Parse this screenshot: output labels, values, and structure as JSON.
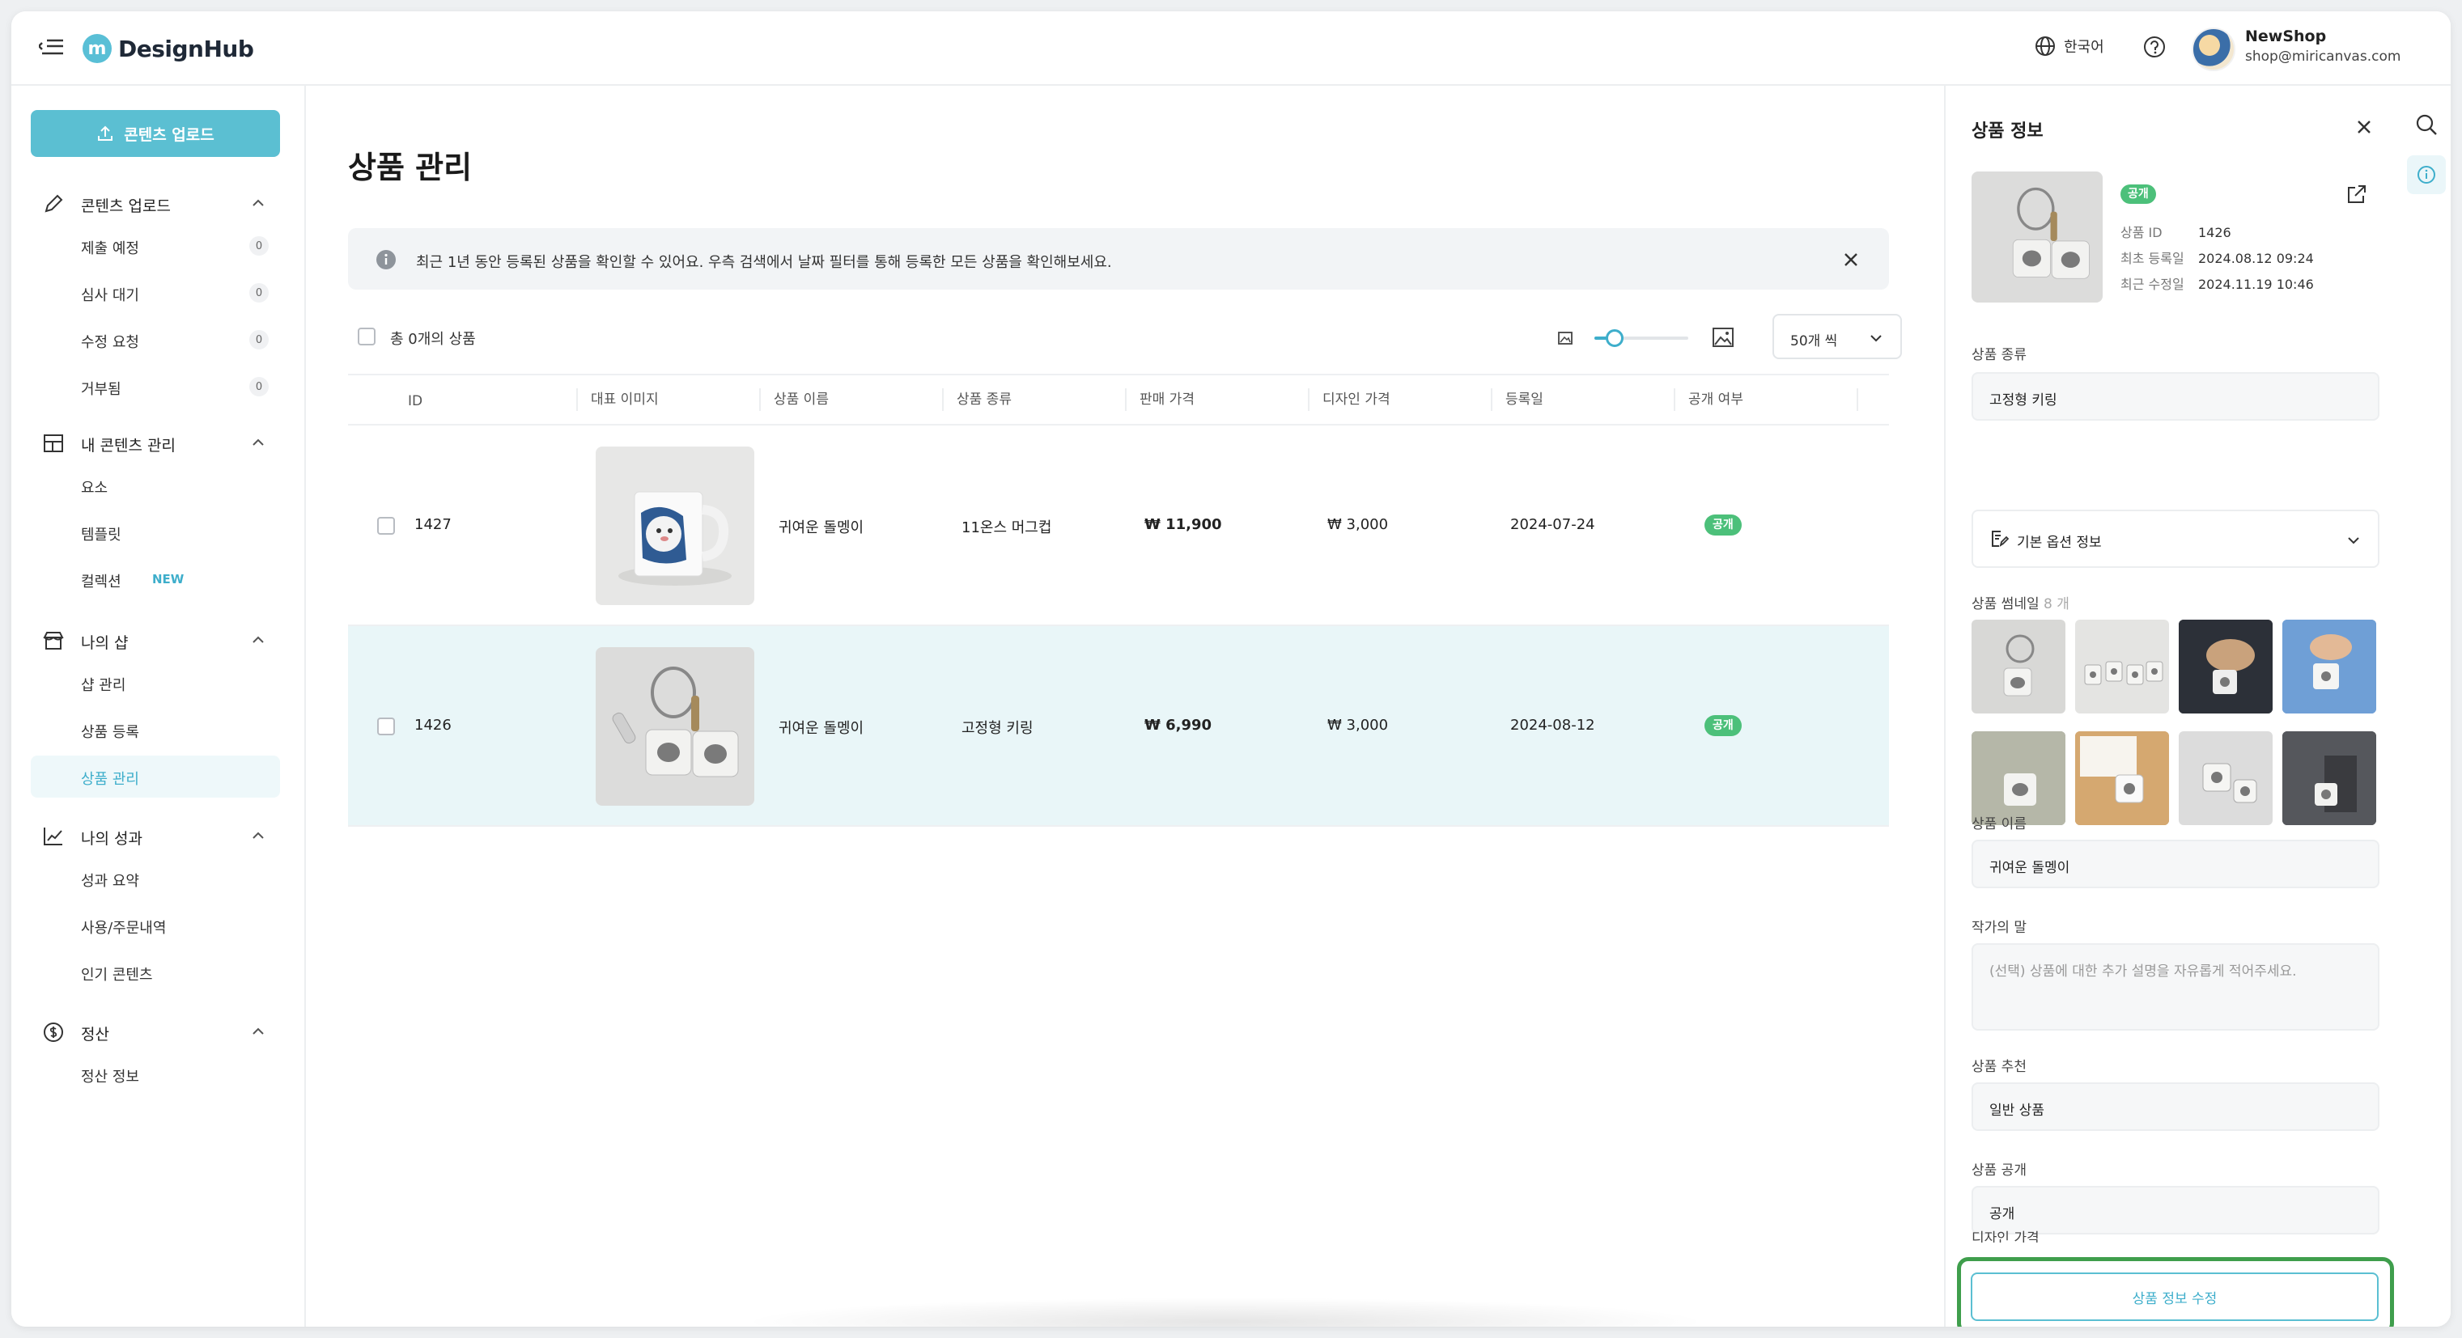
{
  "app": {
    "logo_letter": "m",
    "name": "DesignHub"
  },
  "header": {
    "language": "한국어",
    "user_name": "NewShop",
    "user_email": "shop@miricanvas.com"
  },
  "sidebar": {
    "upload_button": "콘텐츠 업로드",
    "groups": [
      {
        "label": "콘텐츠 업로드",
        "icon": "pencil-icon",
        "items": [
          {
            "label": "제출 예정",
            "count": "0"
          },
          {
            "label": "심사 대기",
            "count": "0"
          },
          {
            "label": "수정 요청",
            "count": "0"
          },
          {
            "label": "거부됨",
            "count": "0"
          }
        ]
      },
      {
        "label": "내 콘텐츠 관리",
        "icon": "grid-icon",
        "items": [
          {
            "label": "요소"
          },
          {
            "label": "템플릿"
          },
          {
            "label": "컬렉션",
            "badge": "NEW"
          }
        ]
      },
      {
        "label": "나의 샵",
        "icon": "store-icon",
        "items": [
          {
            "label": "샵 관리"
          },
          {
            "label": "상품 등록"
          },
          {
            "label": "상품 관리",
            "active": true
          }
        ]
      },
      {
        "label": "나의 성과",
        "icon": "chart-line-icon",
        "items": [
          {
            "label": "성과 요약"
          },
          {
            "label": "사용/주문내역"
          },
          {
            "label": "인기 콘텐츠"
          }
        ]
      },
      {
        "label": "정산",
        "icon": "dollar-circle-icon",
        "items": [
          {
            "label": "정산 정보"
          }
        ]
      }
    ]
  },
  "main": {
    "title": "상품 관리",
    "notice": "최근 1년 동안 등록된 상품을 확인할 수 있어요. 우측 검색에서 날짜 필터를 통해 등록한 모든 상품을 확인해보세요.",
    "total_label": "총 0개의 상품",
    "zoom_level": 0.2,
    "per_page": "50개 씩",
    "columns": [
      "ID",
      "대표 이미지",
      "상품 이름",
      "상품 종류",
      "판매 가격",
      "디자인 가격",
      "등록일",
      "공개 여부"
    ],
    "rows": [
      {
        "id": "1427",
        "name": "귀여운 돌멩이",
        "type": "11온스 머그컵",
        "price": "₩ 11,900",
        "design_price": "₩ 3,000",
        "date": "2024-07-24",
        "status": "공개",
        "selected": false,
        "image": "mug"
      },
      {
        "id": "1426",
        "name": "귀여운 돌멩이",
        "type": "고정형 키링",
        "price": "₩ 6,990",
        "design_price": "₩ 3,000",
        "date": "2024-08-12",
        "status": "공개",
        "selected": true,
        "image": "keyring"
      }
    ]
  },
  "panel": {
    "title": "상품 정보",
    "status": "공개",
    "meta": [
      {
        "key": "상품 ID",
        "value": "1426"
      },
      {
        "key": "최초 등록일",
        "value": "2024.08.12 09:24"
      },
      {
        "key": "최근 수정일",
        "value": "2024.11.19 10:46"
      }
    ],
    "type_label": "상품 종류",
    "type_value": "고정형 키링",
    "options_label": "기본 옵션 정보",
    "thumbnails_label": "상품 썸네일",
    "thumbnails_count": "8 개",
    "name_label": "상품 이름",
    "name_value": "귀여운 돌멩이",
    "note_label": "작가의 말",
    "note_placeholder": "(선택) 상품에 대한 추가 설명을 자유롭게 적어주세요.",
    "recommend_label": "상품 추천",
    "recommend_value": "일반 상품",
    "visibility_label": "상품 공개",
    "visibility_value": "공개",
    "design_price_label": "디자인 가격",
    "edit_button": "상품 정보 수정"
  },
  "colors": {
    "accent": "#5bbfd2",
    "status_green": "#4cc07a",
    "highlight_border": "#3f9e4c",
    "selected_row": "#e9f6f8"
  }
}
